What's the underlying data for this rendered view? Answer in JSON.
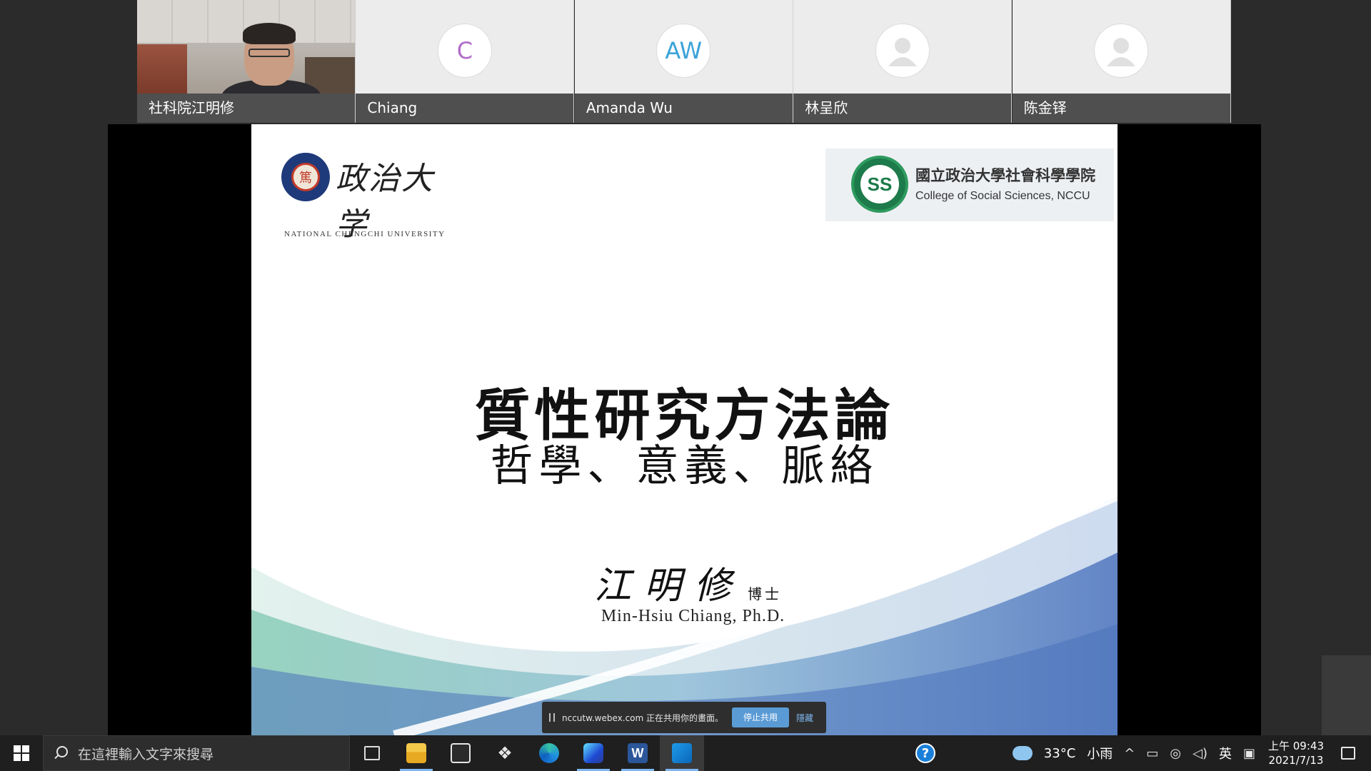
{
  "participants": [
    {
      "name": "社科院江明修",
      "type": "video"
    },
    {
      "name": "Chiang",
      "type": "initial",
      "initials": "C"
    },
    {
      "name": "Amanda Wu",
      "type": "initial",
      "initials": "AW"
    },
    {
      "name": "林呈欣",
      "type": "generic"
    },
    {
      "name": "陈金铎",
      "type": "generic"
    }
  ],
  "slide": {
    "nccu_script": "政治大学",
    "nccu_en": "NATIONAL CHENGCHI UNIVERSITY",
    "nccu_seal_char": "篤",
    "css_emblem_text": "SS",
    "css_name_zh": "國立政治大學社會科學學院",
    "css_name_en": "College of Social Sciences, NCCU",
    "title": "質性研究方法論",
    "subtitle": "哲學、意義、脈絡",
    "sign_script": "江明修",
    "sign_title": "博士",
    "sign_name": "Min-Hsiu Chiang, Ph.D."
  },
  "share_bar": {
    "text": "nccutw.webex.com 正在共用你的畫面。",
    "stop_label": "停止共用",
    "hide_label": "隱藏"
  },
  "taskbar": {
    "search_placeholder": "在這裡輸入文字來搜尋",
    "word_label": "W",
    "help_label": "?",
    "temperature": "33°C",
    "weather": "小雨",
    "ime": "英",
    "time": "上午 09:43",
    "date": "2021/7/13"
  },
  "colors": {
    "stop_button": "#5b9bd5",
    "taskbar": "#1f1f1f",
    "label_bar": "#4f4f4f"
  }
}
